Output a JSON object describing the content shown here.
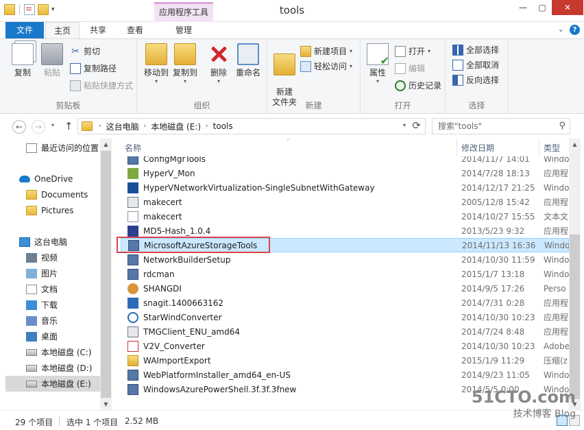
{
  "window": {
    "title": "tools",
    "minimize": "—",
    "maximize": "▢",
    "close": "✕"
  },
  "context_tab": "应用程序工具",
  "tabs": {
    "file": "文件",
    "home": "主页",
    "share": "共享",
    "view": "查看",
    "manage": "管理"
  },
  "ribbon": {
    "clipboard": {
      "label": "剪贴板",
      "copy": "复制",
      "paste": "粘贴",
      "cut": "剪切",
      "copy_path": "复制路径",
      "paste_shortcut": "粘贴快捷方式"
    },
    "organize": {
      "label": "组织",
      "move_to": "移动到",
      "copy_to": "复制到",
      "delete": "删除",
      "rename": "重命名"
    },
    "new": {
      "label": "新建",
      "new_folder": "新建\n文件夹",
      "new_item": "新建项目",
      "easy_access": "轻松访问"
    },
    "open": {
      "label": "打开",
      "properties": "属性",
      "open": "打开",
      "edit": "编辑",
      "history": "历史记录"
    },
    "select": {
      "label": "选择",
      "select_all": "全部选择",
      "select_none": "全部取消",
      "invert": "反向选择"
    }
  },
  "address": {
    "crumbs": [
      "这台电脑",
      "本地磁盘 (E:)",
      "tools"
    ]
  },
  "search": {
    "placeholder": "搜索\"tools\""
  },
  "nav": [
    {
      "label": "最近访问的位置",
      "icon": "recent-icon"
    },
    {
      "label": "OneDrive",
      "icon": "cloud-icon"
    },
    {
      "label": "Documents",
      "icon": "folder-icon"
    },
    {
      "label": "Pictures",
      "icon": "folder-icon"
    },
    {
      "label": "这台电脑",
      "icon": "computer-icon"
    },
    {
      "label": "视频",
      "icon": "videos-icon"
    },
    {
      "label": "图片",
      "icon": "pictures-icon"
    },
    {
      "label": "文档",
      "icon": "documents-icon"
    },
    {
      "label": "下载",
      "icon": "downloads-icon"
    },
    {
      "label": "音乐",
      "icon": "music-icon"
    },
    {
      "label": "桌面",
      "icon": "desktop-icon"
    },
    {
      "label": "本地磁盘 (C:)",
      "icon": "drive-icon"
    },
    {
      "label": "本地磁盘 (D:)",
      "icon": "drive-icon"
    },
    {
      "label": "本地磁盘 (E:)",
      "icon": "drive-icon"
    }
  ],
  "columns": {
    "name": "名称",
    "date": "修改日期",
    "type": "类型"
  },
  "files": [
    {
      "name": "ConfigMgrTools",
      "date": "2014/11/7 14:01",
      "type": "Windo",
      "icon": "setup-icon"
    },
    {
      "name": "HyperV_Mon",
      "date": "2014/7/28 18:13",
      "type": "应用程",
      "icon": "hyperv-icon"
    },
    {
      "name": "HyperVNetworkVirtualization-SingleSubnetWithGateway",
      "date": "2014/12/17 21:25",
      "type": "Windo",
      "icon": "powershell-icon"
    },
    {
      "name": "makecert",
      "date": "2005/12/8 15:42",
      "type": "应用程",
      "icon": "app-icon"
    },
    {
      "name": "makecert",
      "date": "2014/10/27 15:55",
      "type": "文本文",
      "icon": "text-file-icon"
    },
    {
      "name": "MD5-Hash_1.0.4",
      "date": "2013/5/23 9:32",
      "type": "应用程",
      "icon": "md5-icon"
    },
    {
      "name": "MicrosoftAzureStorageTools",
      "date": "2014/11/13 16:36",
      "type": "Windo",
      "icon": "setup-icon"
    },
    {
      "name": "NetworkBuilderSetup",
      "date": "2014/10/30 11:59",
      "type": "Windo",
      "icon": "setup-icon"
    },
    {
      "name": "rdcman",
      "date": "2015/1/7 13:18",
      "type": "Windo",
      "icon": "setup-icon"
    },
    {
      "name": "SHANGDI",
      "date": "2014/9/5 17:26",
      "type": "Perso",
      "icon": "shangdi-icon"
    },
    {
      "name": "snagit.1400663162",
      "date": "2014/7/31 0:28",
      "type": "应用程",
      "icon": "snagit-icon"
    },
    {
      "name": "StarWindConverter",
      "date": "2014/10/30 10:23",
      "type": "应用程",
      "icon": "starwind-icon"
    },
    {
      "name": "TMGClient_ENU_amd64",
      "date": "2014/7/24 8:48",
      "type": "应用程",
      "icon": "app-icon"
    },
    {
      "name": "V2V_Converter",
      "date": "2014/10/30 10:23",
      "type": "Adobe",
      "icon": "pdf-icon"
    },
    {
      "name": "WAImportExport",
      "date": "2015/1/9 11:29",
      "type": "压缩(z",
      "icon": "zip-icon"
    },
    {
      "name": "WebPlatformInstaller_amd64_en-US",
      "date": "2014/9/23 11:05",
      "type": "Windo",
      "icon": "setup-icon"
    },
    {
      "name": "WindowsAzurePowerShell.3f.3f.3fnew",
      "date": "2014/5/5 0:00",
      "type": "Windo",
      "icon": "setup-icon"
    }
  ],
  "status": {
    "count": "29 个项目",
    "selected": "选中 1 个项目",
    "size": "2.52 MB"
  },
  "watermark": {
    "line1": "51CTO.com",
    "line2": "技术博客",
    "line3": "Blog"
  }
}
